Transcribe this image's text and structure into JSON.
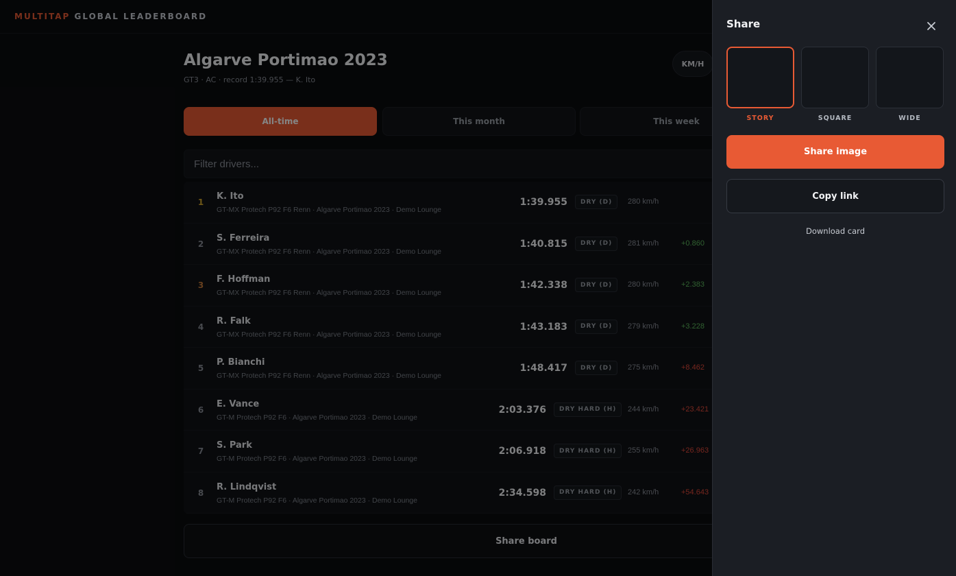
{
  "brand": {
    "accent": "MULTITAP",
    "rest": "GLOBAL LEADERBOARD"
  },
  "board": {
    "title": "Algarve Portimao 2023",
    "subtitle": "GT3 · AC · record 1:39.955 — K. Ito",
    "unit_label": "KM/H",
    "tabs": [
      {
        "label": "All-time",
        "active": true
      },
      {
        "label": "This month",
        "active": false
      },
      {
        "label": "This week",
        "active": false
      }
    ],
    "filter_placeholder": "Filter drivers...",
    "share_label": "Share board"
  },
  "rows": [
    {
      "pos": "1",
      "name": "K. Ito",
      "meta": "GT-MX Protech P92 F6 Renn · Algarve Portimao 2023 · Demo Lounge",
      "time": "1:39.955",
      "tyre": "DRY (D)",
      "speed": "280 km/h",
      "gap": ""
    },
    {
      "pos": "2",
      "name": "S. Ferreira",
      "meta": "GT-MX Protech P92 F6 Renn · Algarve Portimao 2023 · Demo Lounge",
      "time": "1:40.815",
      "tyre": "DRY (D)",
      "speed": "281 km/h",
      "gap": "+0.860"
    },
    {
      "pos": "3",
      "name": "F. Hoffman",
      "meta": "GT-MX Protech P92 F6 Renn · Algarve Portimao 2023 · Demo Lounge",
      "time": "1:42.338",
      "tyre": "DRY (D)",
      "speed": "280 km/h",
      "gap": "+2.383"
    },
    {
      "pos": "4",
      "name": "R. Falk",
      "meta": "GT-MX Protech P92 F6 Renn · Algarve Portimao 2023 · Demo Lounge",
      "time": "1:43.183",
      "tyre": "DRY (D)",
      "speed": "279 km/h",
      "gap": "+3.228"
    },
    {
      "pos": "5",
      "name": "P. Bianchi",
      "meta": "GT-MX Protech P92 F6 Renn · Algarve Portimao 2023 · Demo Lounge",
      "time": "1:48.417",
      "tyre": "DRY (D)",
      "speed": "275 km/h",
      "gap": "+8.462"
    },
    {
      "pos": "6",
      "name": "E. Vance",
      "meta": "GT-M Protech P92 F6 · Algarve Portimao 2023 · Demo Lounge",
      "time": "2:03.376",
      "tyre": "DRY HARD (H)",
      "speed": "244 km/h",
      "gap": "+23.421"
    },
    {
      "pos": "7",
      "name": "S. Park",
      "meta": "GT-M Protech P92 F6 · Algarve Portimao 2023 · Demo Lounge",
      "time": "2:06.918",
      "tyre": "DRY HARD (H)",
      "speed": "255 km/h",
      "gap": "+26.963"
    },
    {
      "pos": "8",
      "name": "R. Lindqvist",
      "meta": "GT-M Protech P92 F6 · Algarve Portimao 2023 · Demo Lounge",
      "time": "2:34.598",
      "tyre": "DRY HARD (H)",
      "speed": "242 km/h",
      "gap": "+54.643"
    }
  ],
  "drawer": {
    "title": "Share",
    "close_icon": "close-icon",
    "formats": [
      {
        "label": "STORY",
        "active": true
      },
      {
        "label": "SQUARE",
        "active": false
      },
      {
        "label": "WIDE",
        "active": false
      }
    ],
    "share_image_label": "Share image",
    "copy_link_label": "Copy link",
    "download_label": "Download card"
  },
  "colors": {
    "accent": "#e85a34",
    "gold": "#d4a72c",
    "bronze": "#c47a3a",
    "gain": "#5cb85c",
    "loss": "#e24a3b"
  }
}
